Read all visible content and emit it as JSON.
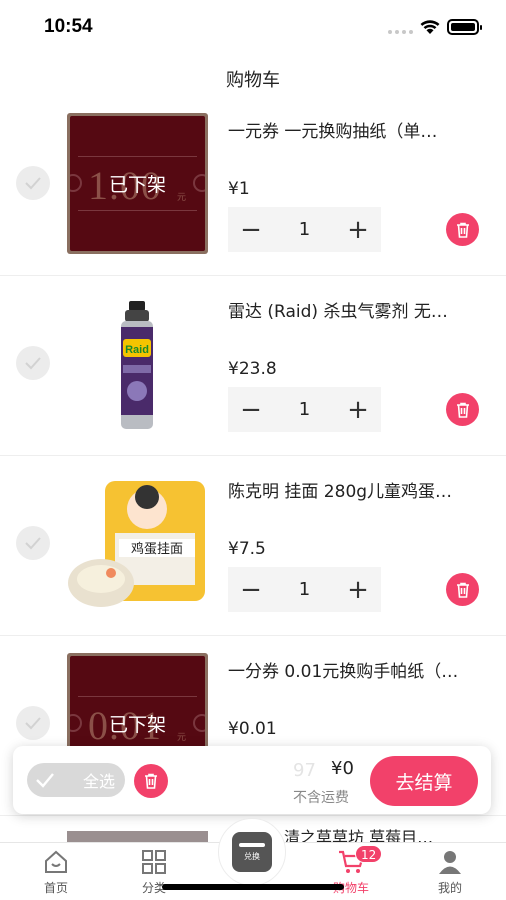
{
  "status": {
    "time": "10:54"
  },
  "header": {
    "title": "购物车"
  },
  "items": [
    {
      "name": "一元券 一元换购抽纸（单…",
      "price": "¥1",
      "qty": "1",
      "image": "coupon",
      "coupon_value": "1.00",
      "coupon_unit": "元",
      "status": "已下架"
    },
    {
      "name": "雷达 (Raid) 杀虫气雾剂 无…",
      "price": "¥23.8",
      "qty": "1",
      "image": "raid-spray",
      "brand": "Raid"
    },
    {
      "name": "陈克明 挂面 280g儿童鸡蛋…",
      "price": "¥7.5",
      "qty": "1",
      "image": "egg-noodles",
      "label": "鸡蛋挂面"
    },
    {
      "name": "一分券 0.01元换购手帕纸（…",
      "price": "¥0.01",
      "qty": "1",
      "image": "coupon",
      "coupon_value": "0.01",
      "coupon_unit": "元",
      "status": "已下架"
    },
    {
      "name": "清之草草坊 草莓目…",
      "price": "",
      "qty": ""
    }
  ],
  "footer": {
    "select_all": "全选",
    "total": "¥0",
    "shipping": "不含运费",
    "checkout": "去结算",
    "hidden_qty": "97"
  },
  "tabs": [
    {
      "label": "首页",
      "icon": "home-icon"
    },
    {
      "label": "分类",
      "icon": "grid-icon"
    },
    {
      "label": "兑换",
      "icon": "exchange-icon",
      "center_text": "兑换"
    },
    {
      "label": "购物车",
      "icon": "cart-icon",
      "badge": "12"
    },
    {
      "label": "我的",
      "icon": "user-icon"
    }
  ],
  "colors": {
    "accent": "#f2416a",
    "coupon": "#6e0f1a"
  }
}
